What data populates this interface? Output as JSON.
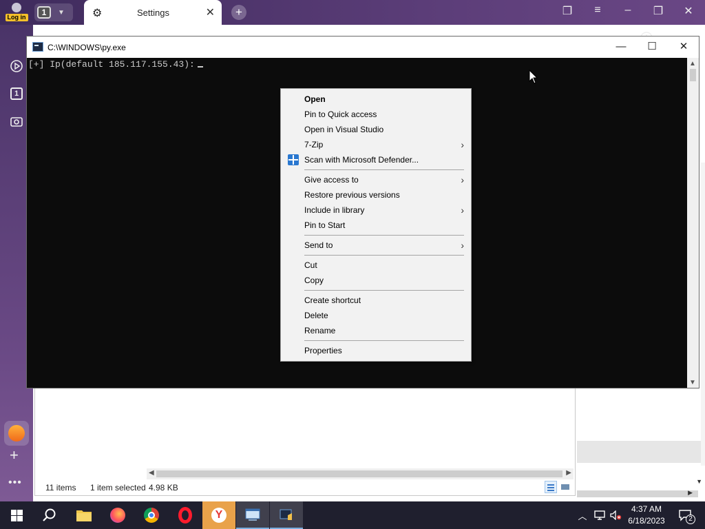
{
  "browser": {
    "login_label": "Log in",
    "tab_count": "1",
    "active_tab_title": "Settings"
  },
  "side_rail": {
    "tab_count": "1"
  },
  "console": {
    "title": "C:\\WINDOWS\\py.exe",
    "prompt_line": "[+] Ip(default 185.117.155.43):"
  },
  "context_menu": {
    "groups": [
      [
        {
          "label": "Open",
          "bold": true
        },
        {
          "label": "Pin to Quick access"
        },
        {
          "label": "Open in Visual Studio"
        },
        {
          "label": "7-Zip",
          "submenu": true
        },
        {
          "label": "Scan with Microsoft Defender...",
          "icon": "defender-shield-icon"
        }
      ],
      [
        {
          "label": "Give access to",
          "submenu": true
        },
        {
          "label": "Restore previous versions"
        },
        {
          "label": "Include in library",
          "submenu": true
        },
        {
          "label": "Pin to Start"
        }
      ],
      [
        {
          "label": "Send to",
          "submenu": true
        }
      ],
      [
        {
          "label": "Cut"
        },
        {
          "label": "Copy"
        }
      ],
      [
        {
          "label": "Create shortcut"
        },
        {
          "label": "Delete"
        },
        {
          "label": "Rename"
        }
      ],
      [
        {
          "label": "Properties"
        }
      ]
    ]
  },
  "explorer": {
    "item_count": "11 items",
    "selection": "1 item selected",
    "size": "4.98 KB"
  },
  "taskbar": {
    "time": "4:37 AM",
    "date": "6/18/2023",
    "notification_count": "2"
  },
  "colors": {
    "console_bg": "#0c0c0c",
    "console_text": "#cccccc",
    "menu_bg": "#f2f2f2",
    "taskbar_bg": "#1f1f2e",
    "yandex_accent": "#e9a24a"
  }
}
